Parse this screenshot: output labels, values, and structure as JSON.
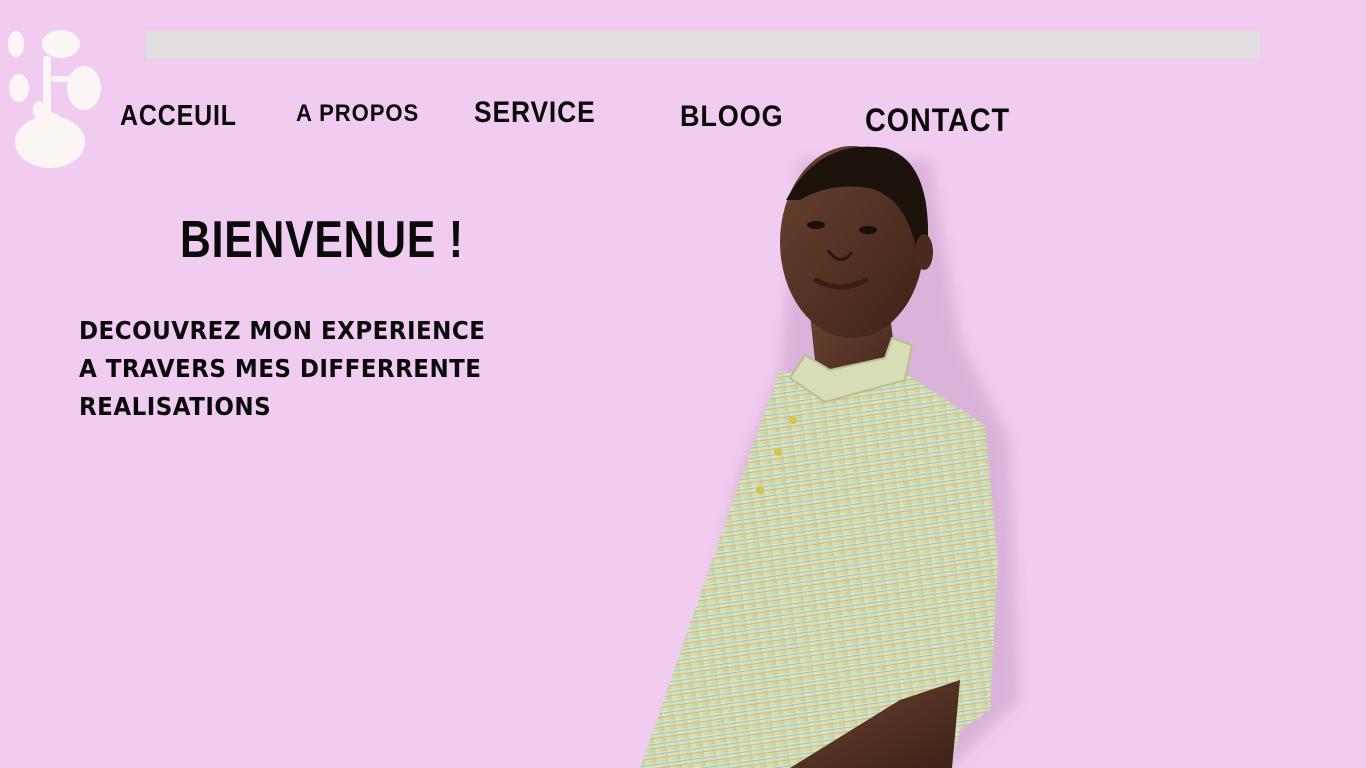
{
  "header": {
    "logo_icon": "tree-logo-icon",
    "search_bar_color": "#e0dede"
  },
  "nav": {
    "items": [
      {
        "label": "ACCEUIL"
      },
      {
        "label": "A PROPOS"
      },
      {
        "label": "SERVICE"
      },
      {
        "label": "BLOOG"
      },
      {
        "label": "CONTACT"
      }
    ]
  },
  "hero": {
    "title": "BIENVENUE !",
    "intro_lines": [
      "DECOUVREZ MON EXPERIENCE",
      "A TRAVERS MES DIFFERRENTE",
      "REALISATIONS"
    ],
    "portrait_icon": "person-portrait-image"
  },
  "colors": {
    "background": "#f0ccf0",
    "text": "#0a0a0a",
    "logo": "#fbf6f4"
  }
}
